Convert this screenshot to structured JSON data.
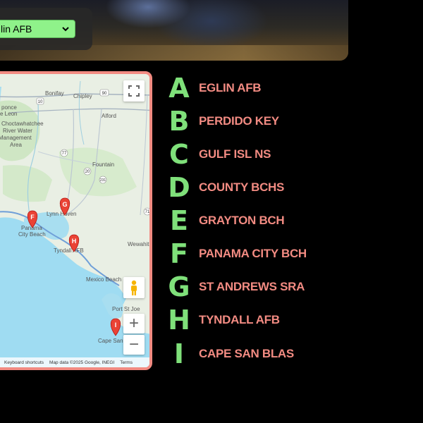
{
  "selector": {
    "value": "Eglin AFB",
    "visible_text": "lin AFB"
  },
  "map": {
    "places": [
      "Bonifay",
      "Chipley",
      "Alford",
      "ponce",
      "e Leon",
      "Choctawhatchee",
      "River Water",
      "Management",
      "Area",
      "Fountain",
      "Lynn Haven",
      "Panama",
      "City Beach",
      "Tyndall AFB",
      "Wewahit",
      "Mexico Beach",
      "Port St Joe",
      "Cape San B"
    ],
    "roads": [
      "90",
      "10",
      "77",
      "231",
      "20",
      "71"
    ],
    "markers": [
      "G",
      "F",
      "H",
      "I"
    ],
    "attribution": {
      "shortcuts": "Keyboard shortcuts",
      "data": "Map data ©2025 Google, INEGI",
      "terms": "Terms"
    },
    "controls": {
      "zoom_in": "+",
      "zoom_out": "−"
    }
  },
  "legend": [
    {
      "letter": "A",
      "label": "EGLIN AFB"
    },
    {
      "letter": "B",
      "label": "PERDIDO KEY"
    },
    {
      "letter": "C",
      "label": "GULF ISL NS"
    },
    {
      "letter": "D",
      "label": "COUNTY BCHS"
    },
    {
      "letter": "E",
      "label": "GRAYTON BCH"
    },
    {
      "letter": "F",
      "label": "PANAMA CITY BCH"
    },
    {
      "letter": "G",
      "label": "ST ANDREWS SRA"
    },
    {
      "letter": "H",
      "label": "TYNDALL AFB"
    },
    {
      "letter": "I",
      "label": "CAPE SAN BLAS"
    }
  ],
  "colors": {
    "letter": "#7fe07a",
    "label": "#f28b82",
    "frame": "#f28b82",
    "select_bg": "#8ff28a",
    "marker": "#ea4335"
  }
}
